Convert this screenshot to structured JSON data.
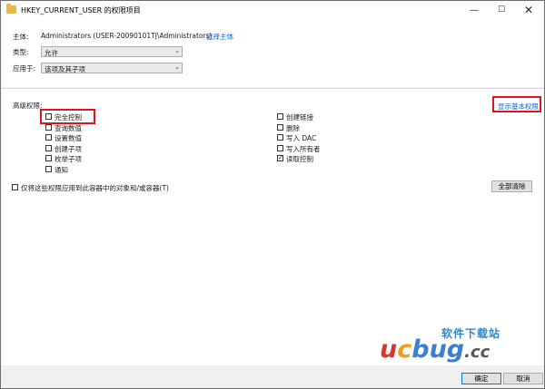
{
  "window": {
    "title": "HKEY_CURRENT_USER 的权限项目",
    "minimize_glyph": "—",
    "maximize_glyph": "☐",
    "close_glyph": "✕",
    "folder_color": "#e8b84a"
  },
  "principal": {
    "label": "主体:",
    "value": "Administrators (USER-20090101TJ\\Administrators)",
    "select_link": "选择主体"
  },
  "type_field": {
    "label": "类型:",
    "value": "允许"
  },
  "applies_to": {
    "label": "应用于:",
    "value": "该项及其子项"
  },
  "advanced": {
    "heading": "高级权限:",
    "show_basic_link": "显示基本权限",
    "left_permissions": [
      {
        "label": "完全控制",
        "checked": false
      },
      {
        "label": "查询数值",
        "checked": false
      },
      {
        "label": "设置数值",
        "checked": false
      },
      {
        "label": "创建子项",
        "checked": false
      },
      {
        "label": "枚举子项",
        "checked": false
      },
      {
        "label": "通知",
        "checked": false
      }
    ],
    "right_permissions": [
      {
        "label": "创建链接",
        "checked": false
      },
      {
        "label": "删除",
        "checked": false
      },
      {
        "label": "写入 DAC",
        "checked": false
      },
      {
        "label": "写入所有者",
        "checked": false
      },
      {
        "label": "读取控制",
        "checked": true
      }
    ],
    "apply_only_label": "仅将这些权限应用到此容器中的对象和/或容器(T)",
    "apply_only_checked": false,
    "clear_all_button": "全部清除"
  },
  "footer": {
    "ok_button": "确定",
    "cancel_button": "取消"
  },
  "watermark": {
    "top_text": "软件下载站",
    "letter_u": "u",
    "letters_c": "c",
    "letters_bug": "bug",
    "suffix": ".cc"
  },
  "colors": {
    "accent_link": "#0066cc",
    "highlight_red": "#e0151b",
    "checkmark": "#222222"
  }
}
